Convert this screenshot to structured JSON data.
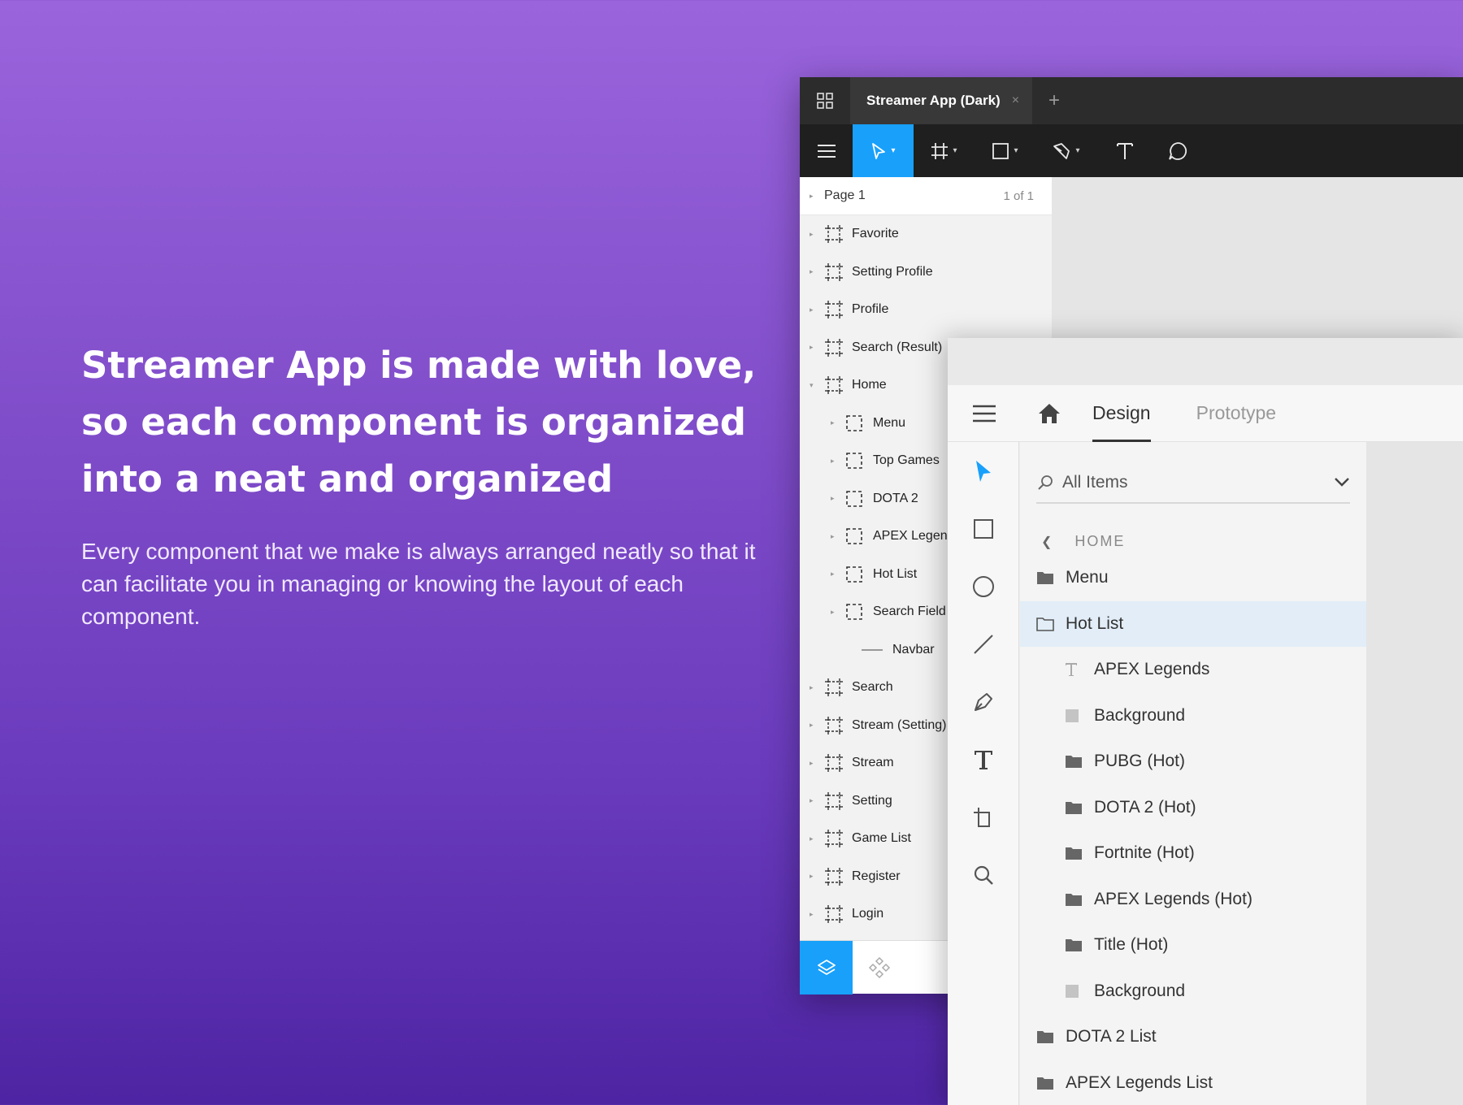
{
  "hero": {
    "heading_line1": "Streamer App is made with love,",
    "heading_line2": "so each component is organized",
    "heading_line3": "into a neat and organized",
    "body": "Every component that we make is always arranged neatly so that it can facilitate you in managing or knowing the layout of each component."
  },
  "back_window": {
    "tab_title": "Streamer App (Dark)",
    "tab_close": "×",
    "tab_add": "+",
    "page": {
      "label": "Page 1",
      "count": "1 of 1"
    },
    "layers": [
      {
        "label": "Favorite"
      },
      {
        "label": "Setting Profile"
      },
      {
        "label": "Profile"
      },
      {
        "label": "Search (Result)"
      },
      {
        "label": "Home"
      }
    ],
    "home_children": [
      {
        "label": "Menu"
      },
      {
        "label": "Top Games"
      },
      {
        "label": "DOTA 2"
      },
      {
        "label": "APEX Legends"
      },
      {
        "label": "Hot List"
      },
      {
        "label": "Search Field"
      },
      {
        "label": "Navbar"
      }
    ],
    "layers_after": [
      {
        "label": "Search"
      },
      {
        "label": "Stream (Setting)"
      },
      {
        "label": "Stream"
      },
      {
        "label": "Setting"
      },
      {
        "label": "Game List"
      },
      {
        "label": "Register"
      },
      {
        "label": "Login"
      }
    ]
  },
  "front_window": {
    "tabs": {
      "design": "Design",
      "prototype": "Prototype"
    },
    "search": {
      "value": "All Items"
    },
    "breadcrumb": "HOME",
    "items": [
      {
        "label": "Menu",
        "type": "folder",
        "depth": 0
      },
      {
        "label": "Hot List",
        "type": "folder-open",
        "depth": 0,
        "selected": true
      },
      {
        "label": "APEX Legends",
        "type": "text",
        "depth": 1
      },
      {
        "label": "Background",
        "type": "rect",
        "depth": 1
      },
      {
        "label": "PUBG (Hot)",
        "type": "folder",
        "depth": 1
      },
      {
        "label": "DOTA 2 (Hot)",
        "type": "folder",
        "depth": 1
      },
      {
        "label": "Fortnite (Hot)",
        "type": "folder",
        "depth": 1
      },
      {
        "label": "APEX Legends (Hot)",
        "type": "folder",
        "depth": 1
      },
      {
        "label": "Title (Hot)",
        "type": "folder",
        "depth": 1
      },
      {
        "label": "Background",
        "type": "rect",
        "depth": 1
      },
      {
        "label": "DOTA 2 List",
        "type": "folder",
        "depth": 0
      },
      {
        "label": "APEX Legends List",
        "type": "folder",
        "depth": 0
      }
    ]
  },
  "colors": {
    "accent": "#18a0fb",
    "selected_row": "#e2edf7"
  }
}
